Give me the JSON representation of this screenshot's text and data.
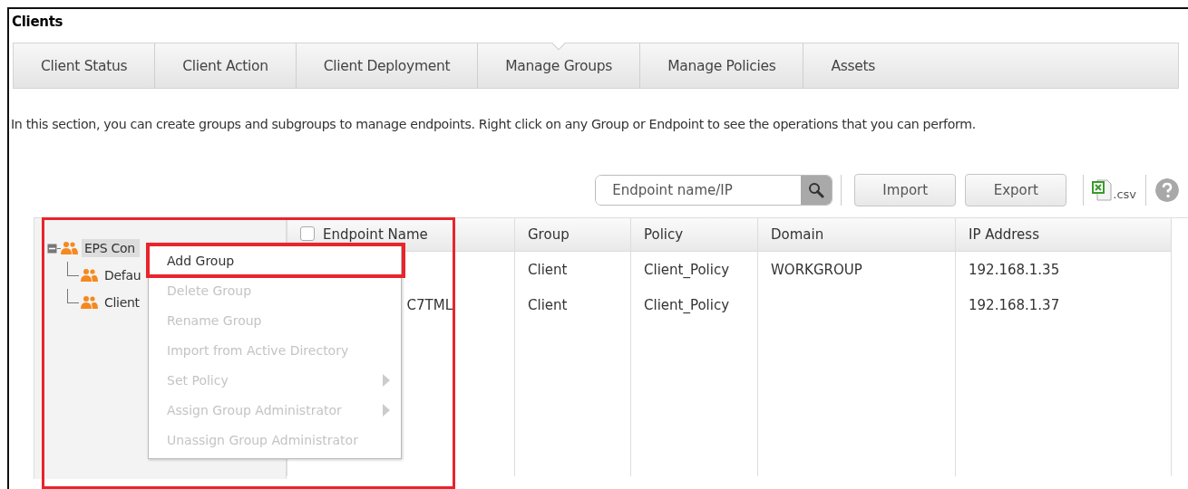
{
  "window": {
    "title": "Clients"
  },
  "tabs": [
    {
      "label": "Client Status",
      "selected": false
    },
    {
      "label": "Client Action",
      "selected": false
    },
    {
      "label": "Client Deployment",
      "selected": false
    },
    {
      "label": "Manage Groups",
      "selected": true
    },
    {
      "label": "Manage Policies",
      "selected": false
    },
    {
      "label": "Assets",
      "selected": false
    }
  ],
  "description": "In this section, you can create groups and subgroups to manage endpoints. Right click on any Group or Endpoint to see the operations that you can perform.",
  "toolbar": {
    "search": {
      "placeholder": "Endpoint name/IP"
    },
    "buttons": [
      "Import",
      "Export"
    ],
    "csv_label": ".csv"
  },
  "tree": [
    {
      "label": "EPS Con",
      "expanded": true,
      "selected": true,
      "children": [
        {
          "label": "Defau",
          "selected": false
        },
        {
          "label": "Client",
          "selected": false
        }
      ]
    }
  ],
  "table": {
    "select_all_checked": false,
    "columns": [
      "Endpoint Name",
      "Group",
      "Policy",
      "Domain",
      "IP Address"
    ],
    "rows": [
      {
        "endpoint_name": "",
        "group": "Client",
        "policy": "Client_Policy",
        "domain": "WORKGROUP",
        "ip_address": "192.168.1.35"
      },
      {
        "endpoint_name": "C7TML",
        "group": "Client",
        "policy": "Client_Policy",
        "domain": "",
        "ip_address": "192.168.1.37"
      }
    ]
  },
  "context_menu": [
    {
      "label": "Add Group",
      "disabled": false,
      "submenu": false,
      "highlighted": true
    },
    {
      "label": "Delete Group",
      "disabled": true,
      "submenu": false,
      "highlighted": false
    },
    {
      "label": "Rename Group",
      "disabled": true,
      "submenu": false,
      "highlighted": false
    },
    {
      "label": "Import from Active Directory",
      "disabled": true,
      "submenu": false,
      "highlighted": false
    },
    {
      "label": "Set Policy",
      "disabled": true,
      "submenu": true,
      "highlighted": false
    },
    {
      "label": "Assign Group Administrator",
      "disabled": true,
      "submenu": true,
      "highlighted": false
    },
    {
      "label": "Unassign Group Administrator",
      "disabled": true,
      "submenu": false,
      "highlighted": false
    }
  ]
}
